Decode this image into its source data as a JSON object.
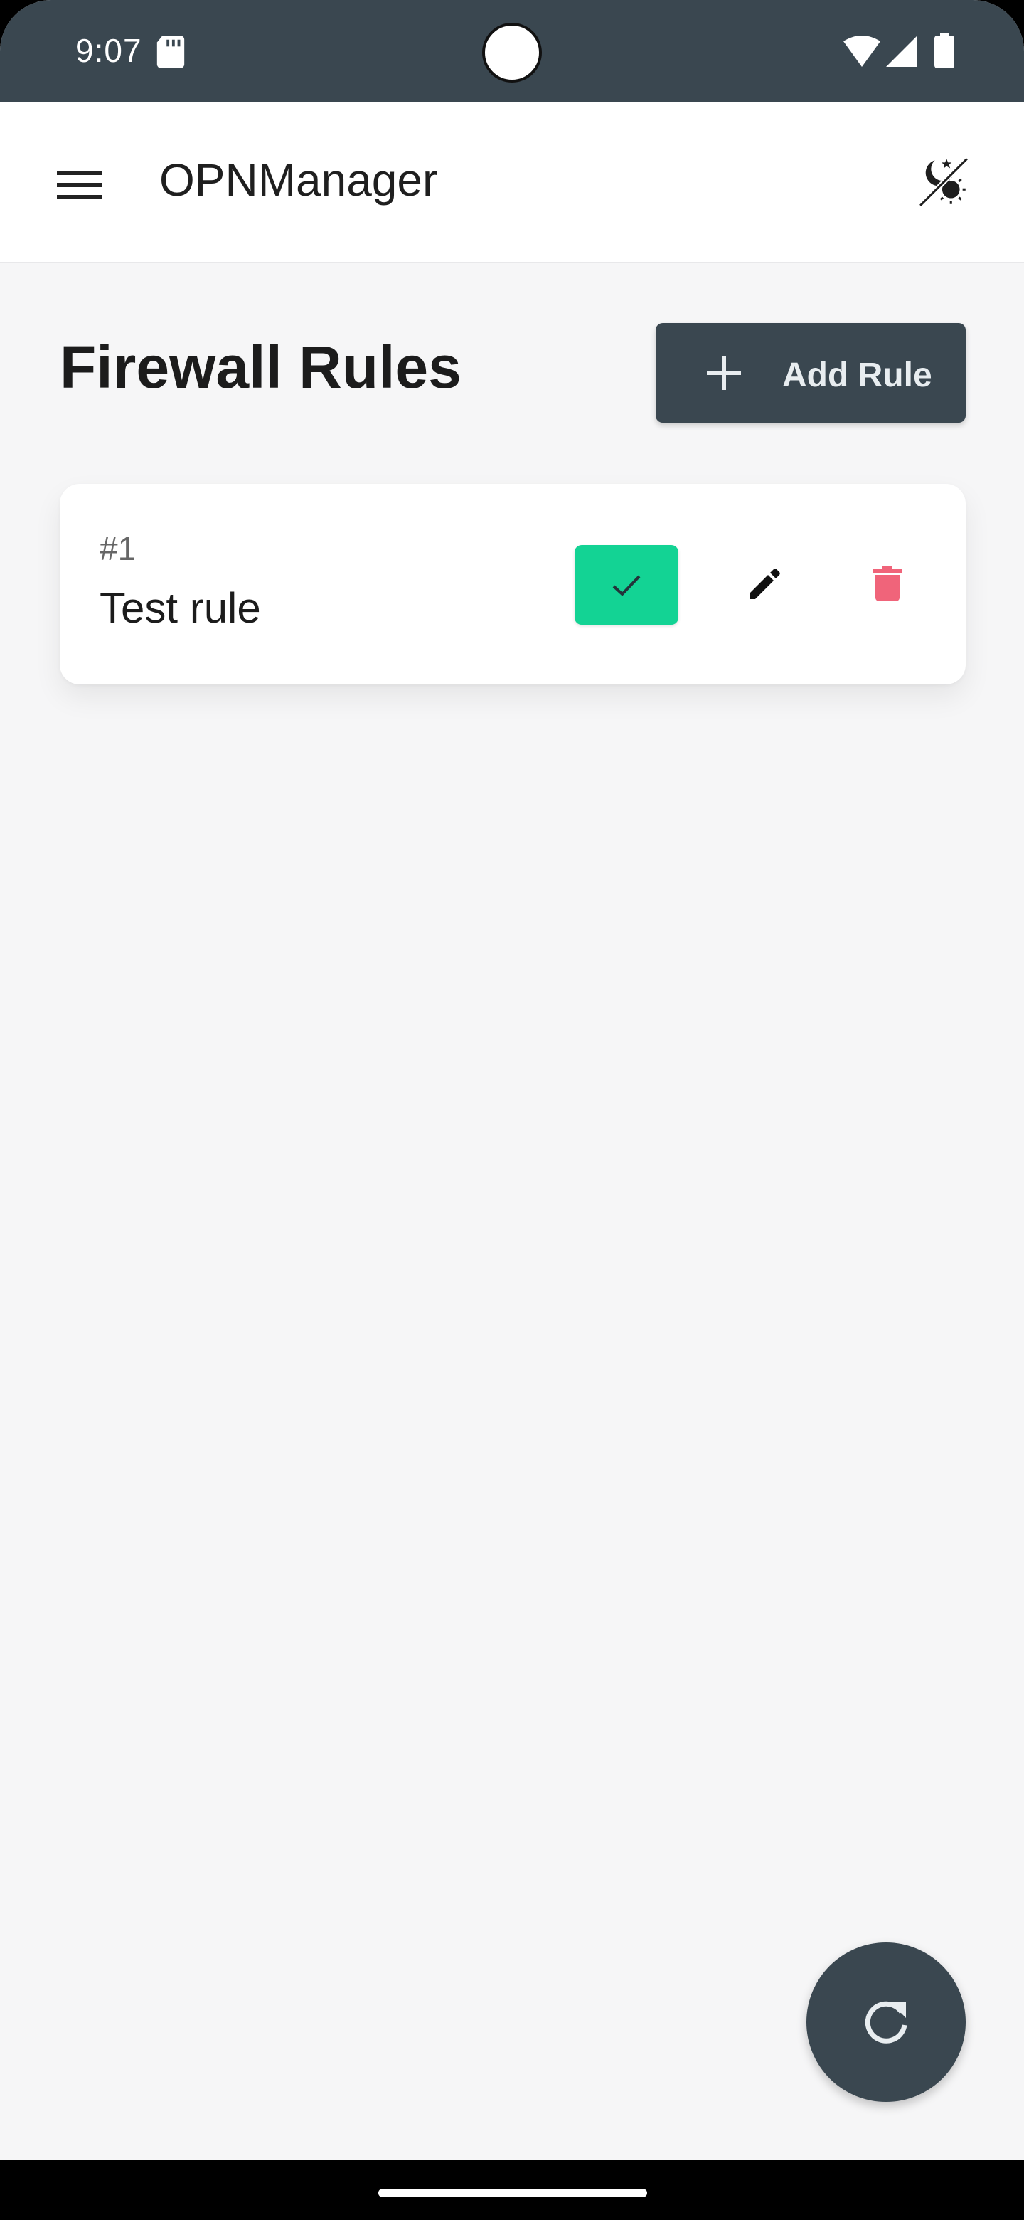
{
  "status_bar": {
    "time": "9:07",
    "icons": [
      "sd-card-icon",
      "wifi-icon",
      "signal-icon",
      "battery-icon"
    ]
  },
  "app_bar": {
    "title": "OPNManager",
    "menu_icon": "hamburger-menu-icon",
    "theme_icon": "theme-toggle-icon"
  },
  "page": {
    "title": "Firewall Rules",
    "add_button_label": "Add Rule",
    "add_button_icon": "plus-icon"
  },
  "rules": [
    {
      "number": "#1",
      "name": "Test rule",
      "enabled": true
    }
  ],
  "fab": {
    "icon": "refresh-icon"
  },
  "colors": {
    "primary": "#3a4750",
    "enabled_green": "#13d394",
    "delete_red": "#f0647a",
    "background": "#f6f6f7"
  }
}
